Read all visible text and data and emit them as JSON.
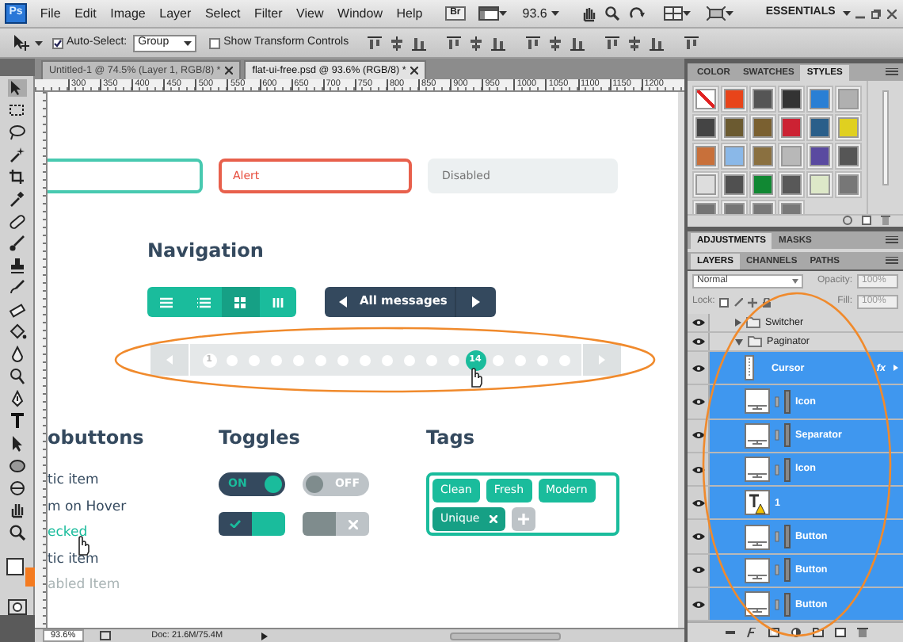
{
  "app_logo": "Ps",
  "menu": [
    "File",
    "Edit",
    "Image",
    "Layer",
    "Select",
    "Filter",
    "View",
    "Window",
    "Help"
  ],
  "bridge_button": "Br",
  "zoom_menu": "93.6",
  "workspace": "ESSENTIALS",
  "options_bar": {
    "auto_select": {
      "label": "Auto-Select:",
      "checked": true,
      "value": "Group"
    },
    "transform_controls": {
      "label": "Show Transform Controls",
      "checked": false
    }
  },
  "document_tabs": [
    {
      "title": "Untitled-1 @ 74.5% (Layer 1, RGB/8) *",
      "selected": false
    },
    {
      "title": "flat-ui-free.psd @ 93.6% (RGB/8) *",
      "selected": true
    }
  ],
  "ruler_marks": [
    "300",
    "350",
    "400",
    "450",
    "500",
    "550",
    "600",
    "650",
    "700",
    "750",
    "800",
    "850",
    "900",
    "950",
    "1000",
    "1050",
    "1100",
    "1150",
    "1200"
  ],
  "tool_colors": [
    {
      "color": "#ffffff"
    },
    {
      "color": "#f47b20"
    }
  ],
  "canvas": {
    "inputs": [
      {
        "kind": "success",
        "disabled": false
      },
      {
        "kind": "error",
        "value": "Alert",
        "disabled": false
      },
      {
        "kind": "plain",
        "placeholder": "Disabled",
        "disabled": true
      }
    ],
    "navigation": {
      "title": "Navigation",
      "view_buttons": [
        {
          "kind": "list",
          "selected": false
        },
        {
          "kind": "rows",
          "selected": false
        },
        {
          "kind": "grid",
          "selected": true
        },
        {
          "kind": "columns",
          "selected": false
        }
      ],
      "pager_label": "All messages",
      "pages": [
        {
          "label": "1",
          "selected": false
        },
        {
          "selected": false
        },
        {
          "selected": false
        },
        {
          "selected": false
        },
        {
          "selected": false
        },
        {
          "selected": false
        },
        {
          "selected": false
        },
        {
          "selected": false
        },
        {
          "selected": false
        },
        {
          "selected": false
        },
        {
          "selected": false
        },
        {
          "selected": false
        },
        {
          "label": "14",
          "selected": true
        },
        {
          "selected": false
        },
        {
          "selected": false
        },
        {
          "selected": false
        },
        {
          "selected": false
        }
      ]
    },
    "radio_section": {
      "title": "obuttons",
      "items": [
        {
          "label": "tic item",
          "kind": "normal"
        },
        {
          "label": "m on Hover",
          "kind": "hover"
        },
        {
          "label": "ecked",
          "kind": "checked"
        },
        {
          "label": "tic item",
          "kind": "normal"
        },
        {
          "label": "abled Item",
          "kind": "disabled"
        }
      ]
    },
    "toggles_section": {
      "title": "Toggles",
      "toggles": [
        {
          "kind": "text",
          "label": "ON",
          "on": true
        },
        {
          "kind": "text",
          "label": "OFF",
          "on": false
        },
        {
          "kind": "icon",
          "on": true
        },
        {
          "kind": "icon",
          "on": false
        }
      ]
    },
    "tags_section": {
      "title": "Tags",
      "tags": [
        {
          "label": "Clean",
          "removable": false
        },
        {
          "label": "Fresh",
          "removable": false
        },
        {
          "label": "Modern",
          "removable": false
        },
        {
          "label": "Unique",
          "removable": true
        }
      ]
    }
  },
  "status_bar": {
    "zoom": "93.6%",
    "doc_size": "Doc: 21.6M/75.4M"
  },
  "styles_panel": {
    "tabs": [
      {
        "label": "COLOR",
        "selected": false
      },
      {
        "label": "SWATCHES",
        "selected": false
      },
      {
        "label": "STYLES",
        "selected": true
      }
    ],
    "styles": [
      {
        "kind": "none",
        "color": "#ffffff"
      },
      {
        "kind": "swatch",
        "color": "#e8441a"
      },
      {
        "kind": "swatch",
        "color": "#555555"
      },
      {
        "kind": "swatch",
        "color": "#333333"
      },
      {
        "kind": "swatch",
        "color": "#2a7fd4"
      },
      {
        "kind": "swatch",
        "color": "#b0b0b0"
      },
      {
        "kind": "swatch",
        "color": "#444444"
      },
      {
        "kind": "swatch",
        "color": "#6b5a30"
      },
      {
        "kind": "swatch",
        "color": "#7a6030"
      },
      {
        "kind": "swatch",
        "color": "#cc2233"
      },
      {
        "kind": "swatch",
        "color": "#2a5f8a"
      },
      {
        "kind": "swatch",
        "color": "#e0d020"
      },
      {
        "kind": "swatch",
        "color": "#c8703a"
      },
      {
        "kind": "swatch",
        "color": "#8ab8e8"
      },
      {
        "kind": "swatch",
        "color": "#8a7040"
      },
      {
        "kind": "swatch",
        "color": "#b8b8b8"
      },
      {
        "kind": "swatch",
        "color": "#5a4aa0"
      },
      {
        "kind": "swatch",
        "color": "#565656"
      },
      {
        "kind": "swatch",
        "color": "#dddddd"
      },
      {
        "kind": "swatch",
        "color": "#505050"
      },
      {
        "kind": "swatch",
        "color": "#118833"
      },
      {
        "kind": "swatch",
        "color": "#585858"
      },
      {
        "kind": "swatch",
        "color": "#dde8c8"
      },
      {
        "kind": "swatch",
        "color": "#777777"
      },
      {
        "kind": "swatch",
        "color": "#747474"
      },
      {
        "kind": "swatch",
        "color": "#767676"
      },
      {
        "kind": "swatch",
        "color": "#787878"
      },
      {
        "kind": "swatch",
        "color": "#797979"
      }
    ]
  },
  "adjustments_tabs": [
    {
      "label": "ADJUSTMENTS",
      "selected": true
    },
    {
      "label": "MASKS",
      "selected": false
    }
  ],
  "layers_panel": {
    "tabs": [
      {
        "label": "LAYERS",
        "selected": true
      },
      {
        "label": "CHANNELS",
        "selected": false
      },
      {
        "label": "PATHS",
        "selected": false
      }
    ],
    "blend_mode": "Normal",
    "opacity_label": "Opacity:",
    "opacity": "100%",
    "lock_label": "Lock:",
    "fill_label": "Fill:",
    "fill": "100%",
    "layers": [
      {
        "name": "Switcher",
        "kind": "group",
        "expanded": false,
        "selected": false,
        "visible": true
      },
      {
        "name": "Paginator",
        "kind": "group",
        "expanded": true,
        "selected": false,
        "visible": true,
        "children": [
          {
            "name": "Cursor",
            "kind": "shape",
            "selected": true,
            "visible": true,
            "effect": "fx"
          },
          {
            "name": "Icon",
            "kind": "layer",
            "selected": true,
            "visible": true
          },
          {
            "name": "Separator",
            "kind": "layer",
            "selected": true,
            "visible": true
          },
          {
            "name": "Icon",
            "kind": "layer",
            "selected": true,
            "visible": true
          },
          {
            "name": "1",
            "kind": "text",
            "selected": true,
            "visible": true
          },
          {
            "name": "Button",
            "kind": "layer",
            "selected": true,
            "visible": true
          },
          {
            "name": "Button",
            "kind": "layer",
            "selected": true,
            "visible": true
          },
          {
            "name": "Button",
            "kind": "layer",
            "selected": true,
            "visible": true
          }
        ]
      }
    ]
  }
}
